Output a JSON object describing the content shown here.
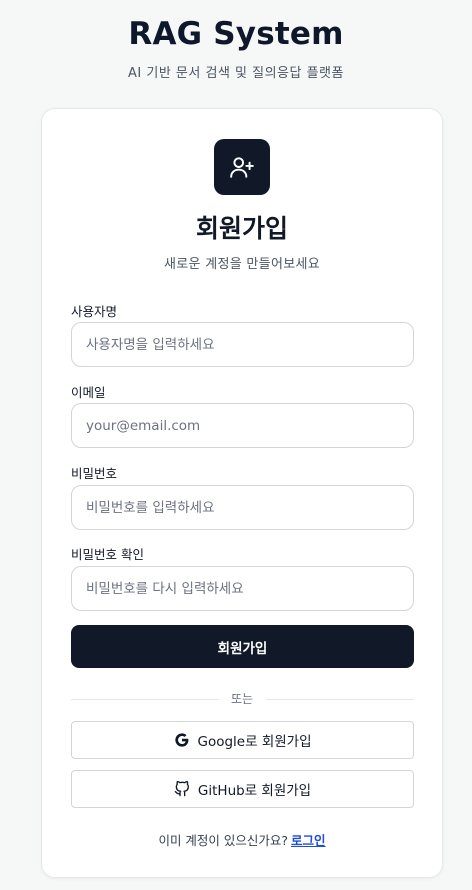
{
  "header": {
    "title": "RAG System",
    "subtitle": "AI 기반 문서 검색 및 질의응답 플랫폼"
  },
  "card": {
    "logo_icon": "user-plus-icon",
    "title": "회원가입",
    "subtitle": "새로운 계정을 만들어보세요"
  },
  "form": {
    "username": {
      "label": "사용자명",
      "placeholder": "사용자명을 입력하세요",
      "value": ""
    },
    "email": {
      "label": "이메일",
      "placeholder": "your@email.com",
      "value": ""
    },
    "password": {
      "label": "비밀번호",
      "placeholder": "비밀번호를 입력하세요",
      "value": ""
    },
    "password_confirm": {
      "label": "비밀번호 확인",
      "placeholder": "비밀번호를 다시 입력하세요",
      "value": ""
    },
    "submit_label": "회원가입"
  },
  "divider_text": "또는",
  "oauth": {
    "google": {
      "label": "Google로 회원가입",
      "icon": "google-icon"
    },
    "github": {
      "label": "GitHub로 회원가입",
      "icon": "github-icon"
    }
  },
  "footer": {
    "prompt": "이미 계정이 있으신가요?",
    "login_link": "로그인"
  },
  "colors": {
    "primary": "#111827",
    "link": "#1d4ed8",
    "background": "#f6f8f8"
  }
}
